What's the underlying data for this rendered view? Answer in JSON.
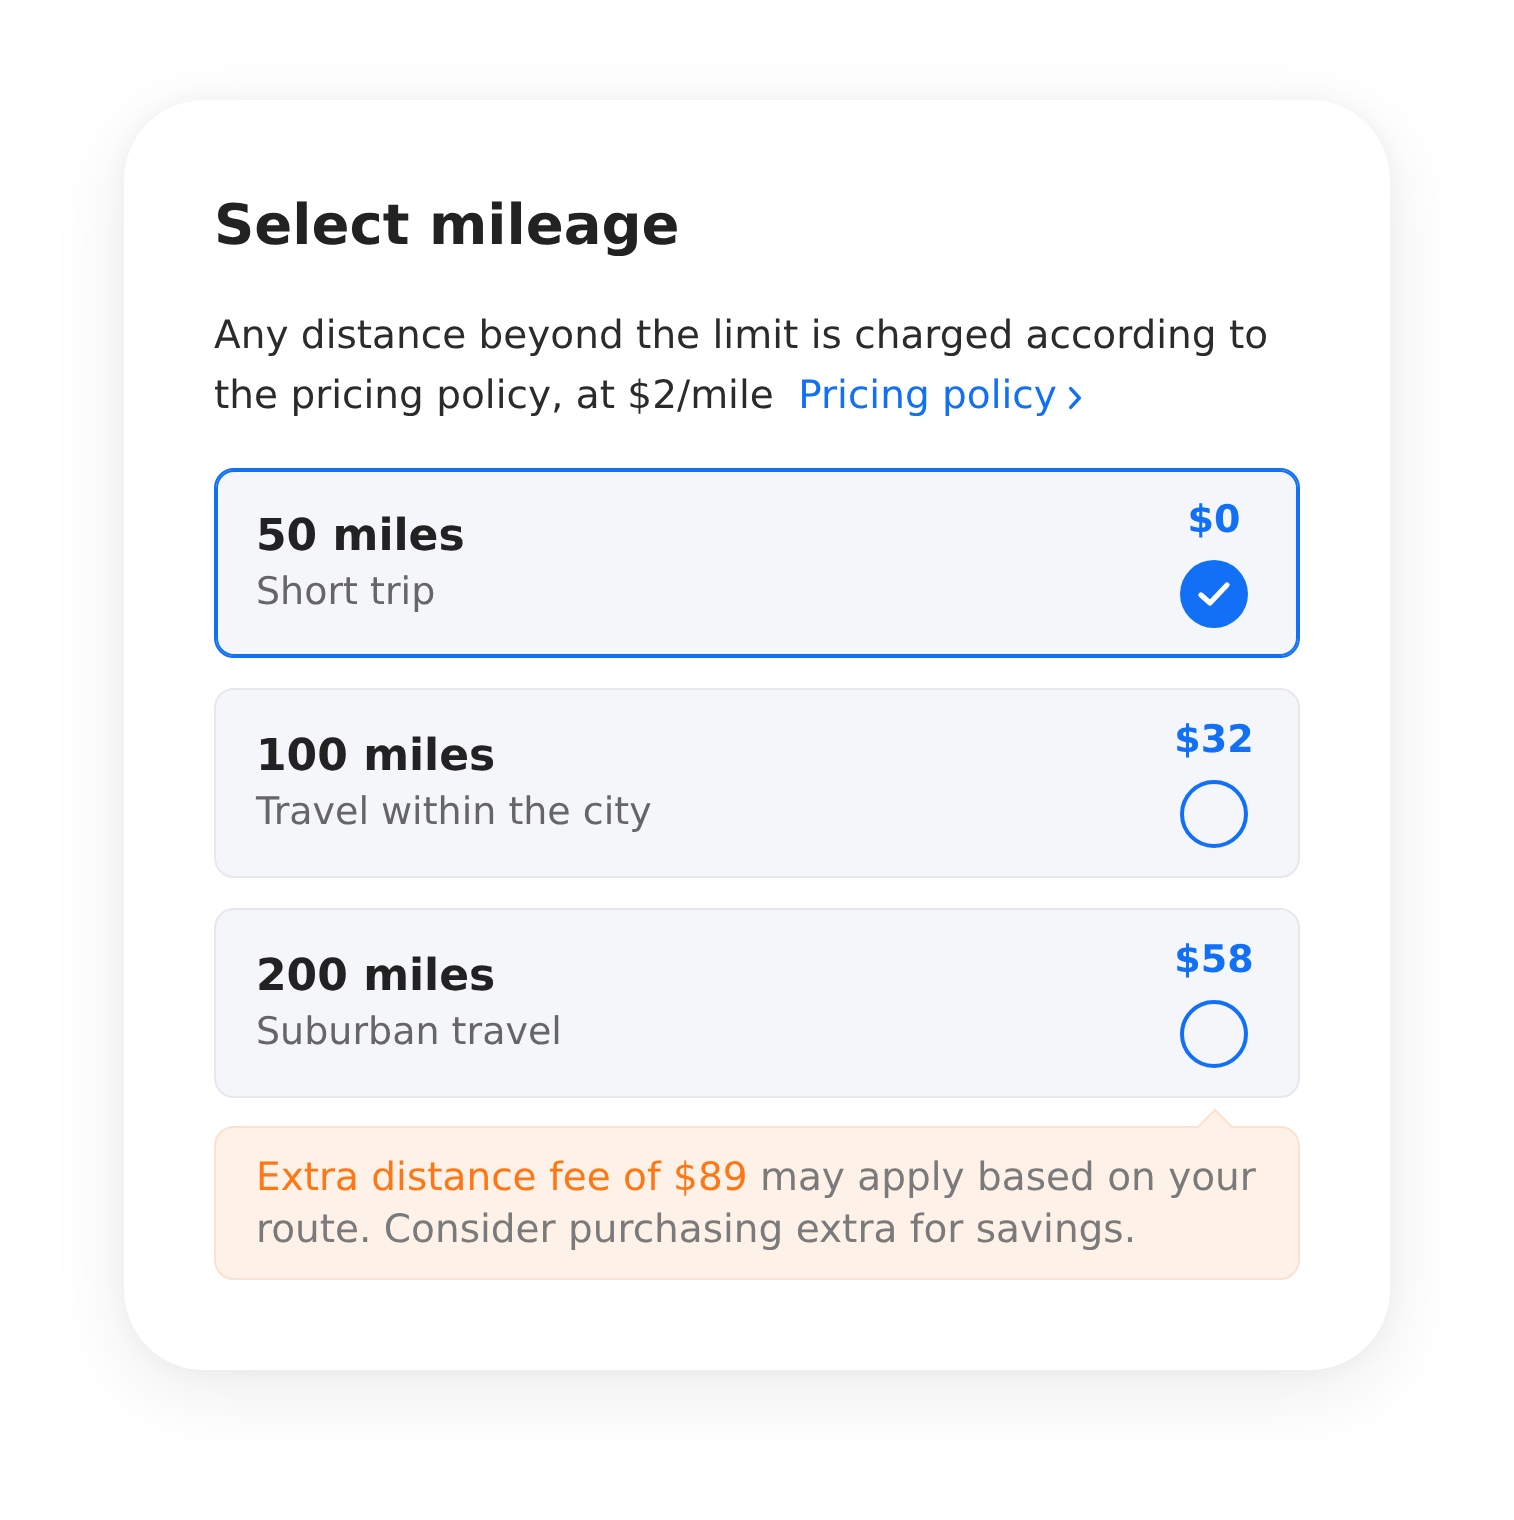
{
  "title": "Select mileage",
  "description": {
    "text": "Any distance beyond the limit is charged according to the pricing policy, at $2/mile",
    "link": "Pricing policy"
  },
  "options": [
    {
      "miles": "50 miles",
      "label": "Short trip",
      "price": "$0",
      "selected": true
    },
    {
      "miles": "100 miles",
      "label": "Travel within the city",
      "price": "$32",
      "selected": false
    },
    {
      "miles": "200 miles",
      "label": "Suburban travel",
      "price": "$58",
      "selected": false
    }
  ],
  "notice": {
    "highlight": "Extra distance fee of $89",
    "text": "may apply based on your route. Consider purchasing extra for savings."
  }
}
